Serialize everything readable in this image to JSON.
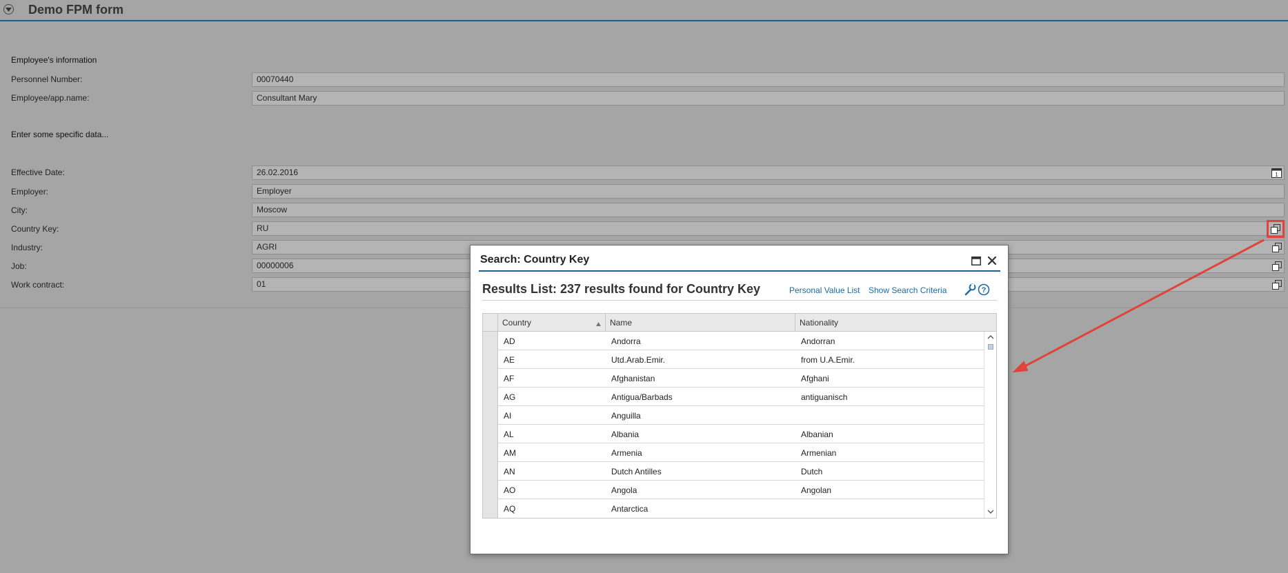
{
  "header": {
    "title": "Demo FPM form"
  },
  "form": {
    "section1": "Employee's information",
    "personnel_number": {
      "label": "Personnel Number:",
      "value": "00070440"
    },
    "employee_name": {
      "label": "Employee/app.name:",
      "value": "Consultant Mary"
    },
    "section2": "Enter some specific data...",
    "effective_date": {
      "label": "Effective Date:",
      "value": "26.02.2016",
      "calendar_day": "1"
    },
    "employer": {
      "label": "Employer:",
      "value": "Employer"
    },
    "city": {
      "label": "City:",
      "value": "Moscow"
    },
    "country_key": {
      "label": "Country Key:",
      "value": "RU"
    },
    "industry": {
      "label": "Industry:",
      "value": "AGRI"
    },
    "job": {
      "label": "Job:",
      "value": "00000006"
    },
    "work_contract": {
      "label": "Work contract:",
      "value": "01"
    }
  },
  "dialog": {
    "title": "Search: Country Key",
    "results_title": "Results List: 237 results found for Country Key",
    "links": {
      "personal_value_list": "Personal Value List",
      "show_search_criteria": "Show Search Criteria"
    },
    "columns": [
      "Country",
      "Name",
      "Nationality"
    ],
    "rows": [
      {
        "country": "AD",
        "name": "Andorra",
        "nationality": "Andorran"
      },
      {
        "country": "AE",
        "name": "Utd.Arab.Emir.",
        "nationality": "from U.A.Emir."
      },
      {
        "country": "AF",
        "name": "Afghanistan",
        "nationality": "Afghani"
      },
      {
        "country": "AG",
        "name": "Antigua/Barbads",
        "nationality": "antiguanisch"
      },
      {
        "country": "AI",
        "name": "Anguilla",
        "nationality": ""
      },
      {
        "country": "AL",
        "name": "Albania",
        "nationality": "Albanian"
      },
      {
        "country": "AM",
        "name": "Armenia",
        "nationality": "Armenian"
      },
      {
        "country": "AN",
        "name": "Dutch Antilles",
        "nationality": "Dutch"
      },
      {
        "country": "AO",
        "name": "Angola",
        "nationality": "Angolan"
      },
      {
        "country": "AQ",
        "name": "Antarctica",
        "nationality": ""
      }
    ]
  },
  "colors": {
    "accent_blue": "#1d5f8c",
    "link_blue": "#1a6aa8",
    "annotation_red": "#e0433a",
    "overlay_gray": "#a5a5a5"
  }
}
